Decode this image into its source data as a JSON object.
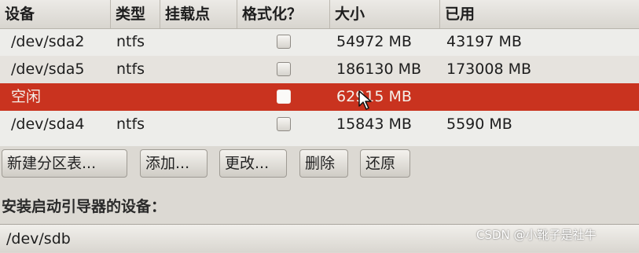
{
  "table": {
    "headers": [
      "设备",
      "类型",
      "挂载点",
      "格式化？",
      "大小",
      "已用"
    ],
    "rows": [
      {
        "device": "/dev/sda2",
        "type": "ntfs",
        "mount": "",
        "format": false,
        "size": "54972 MB",
        "used": "43197 MB"
      },
      {
        "device": "/dev/sda5",
        "type": "ntfs",
        "mount": "",
        "format": false,
        "size": "186130 MB",
        "used": "173008 MB"
      },
      {
        "device": "空闲",
        "type": "",
        "mount": "",
        "format": false,
        "size": "62915 MB",
        "used": "",
        "selected": true
      },
      {
        "device": "/dev/sda4",
        "type": "ntfs",
        "mount": "",
        "format": false,
        "size": "15843 MB",
        "used": "5590 MB"
      }
    ]
  },
  "buttons": {
    "new_table": "新建分区表...",
    "add": "添加...",
    "change": "更改...",
    "delete": "删除",
    "revert": "还原"
  },
  "boot": {
    "label": "安装启动引导器的设备：",
    "device": "/dev/sdb"
  },
  "watermark": "CSDN @小靴子是社牛",
  "colors": {
    "selected_row": "#c9331f"
  },
  "icons": [
    "mouse-cursor-icon"
  ]
}
